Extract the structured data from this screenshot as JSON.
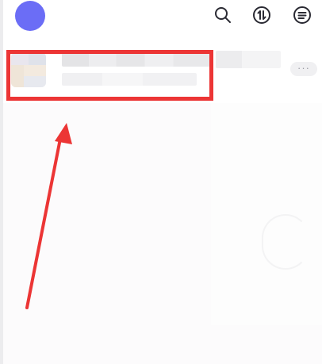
{
  "topbar": {
    "icons": [
      "search-icon",
      "transfer-icon",
      "menu-icon"
    ]
  },
  "chat_list": {
    "items": [
      {
        "name": "",
        "preview": "",
        "more_label": "···"
      }
    ]
  },
  "annotation": {
    "highlight_color": "#ec3535",
    "arrow_color": "#ec3535"
  },
  "colors": {
    "avatar": "#6b6df6",
    "icon": "#2a2a33"
  }
}
